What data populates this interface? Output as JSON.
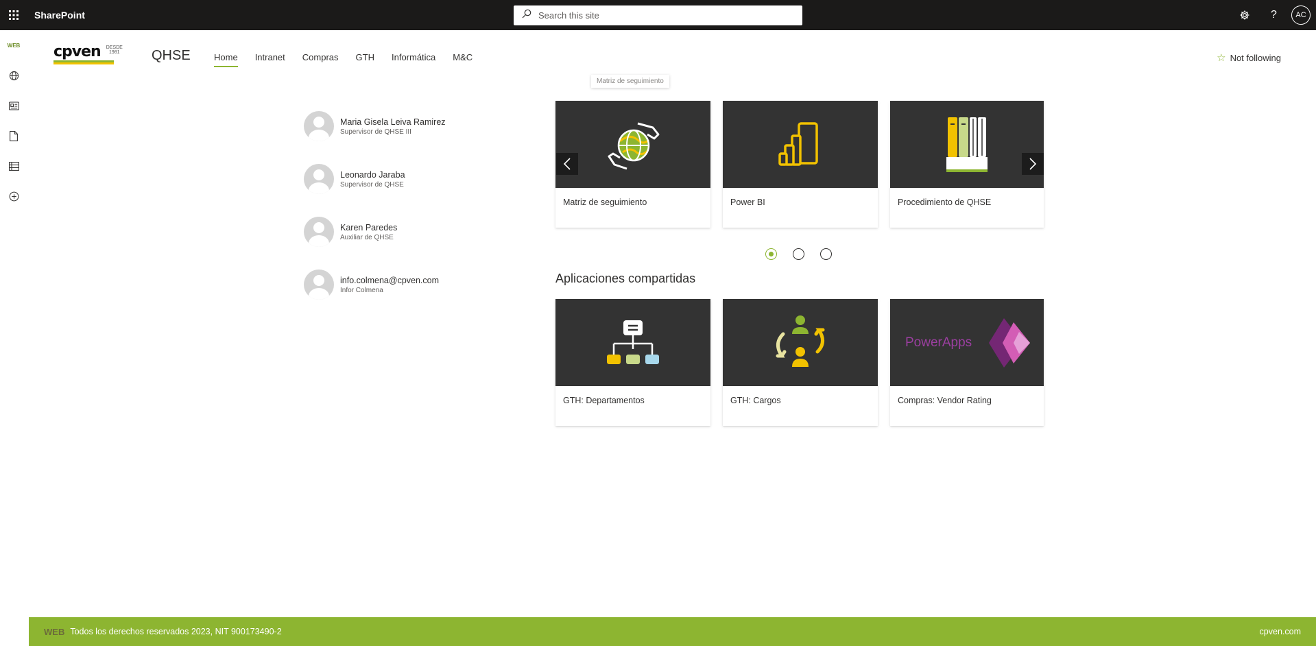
{
  "suitebar": {
    "app_name": "SharePoint",
    "search_placeholder": "Search this site",
    "user_initials": "AC"
  },
  "appbar": {
    "web_label": "WEB"
  },
  "site": {
    "logo_text": "cpven",
    "logo_desde": "DESDE",
    "logo_year": "1981",
    "title": "QHSE",
    "nav": [
      "Home",
      "Intranet",
      "Compras",
      "GTH",
      "Informática",
      "M&C"
    ],
    "follow_label": "Not following"
  },
  "people": [
    {
      "name": "Maria Gisela Leiva Ramirez",
      "role": "Supervisor de QHSE III"
    },
    {
      "name": "Leonardo Jaraba",
      "role": "Supervisor de QHSE"
    },
    {
      "name": "Karen Paredes",
      "role": "Auxiliar de QHSE"
    },
    {
      "name": "info.colmena@cpven.com",
      "role": "Infor Colmena"
    }
  ],
  "carousel": {
    "tooltip": "Matriz de seguimiento",
    "tiles": [
      {
        "label": "Matriz de seguimiento",
        "icon": "globe-hands-icon"
      },
      {
        "label": "Power BI",
        "icon": "power-bi-icon"
      },
      {
        "label": "Procedimiento de QHSE",
        "icon": "binders-icon"
      }
    ],
    "pages": 3,
    "active_page": 1
  },
  "shared_apps": {
    "title": "Aplicaciones compartidas",
    "tiles": [
      {
        "label": "GTH: Departamentos",
        "icon": "org-chart-icon"
      },
      {
        "label": "GTH: Cargos",
        "icon": "people-cycle-icon"
      },
      {
        "label": "Compras: Vendor Rating",
        "icon": "powerapps-icon",
        "icon_text": "PowerApps"
      }
    ]
  },
  "footer": {
    "web": "WEB",
    "text": "Todos los derechos reservados 2023, NIT 900173490-2",
    "right": "cpven.com"
  },
  "colors": {
    "accent": "#8db531",
    "suitebar": "#1b1a19",
    "tile_bg": "#333333",
    "yellow": "#f2c200"
  }
}
